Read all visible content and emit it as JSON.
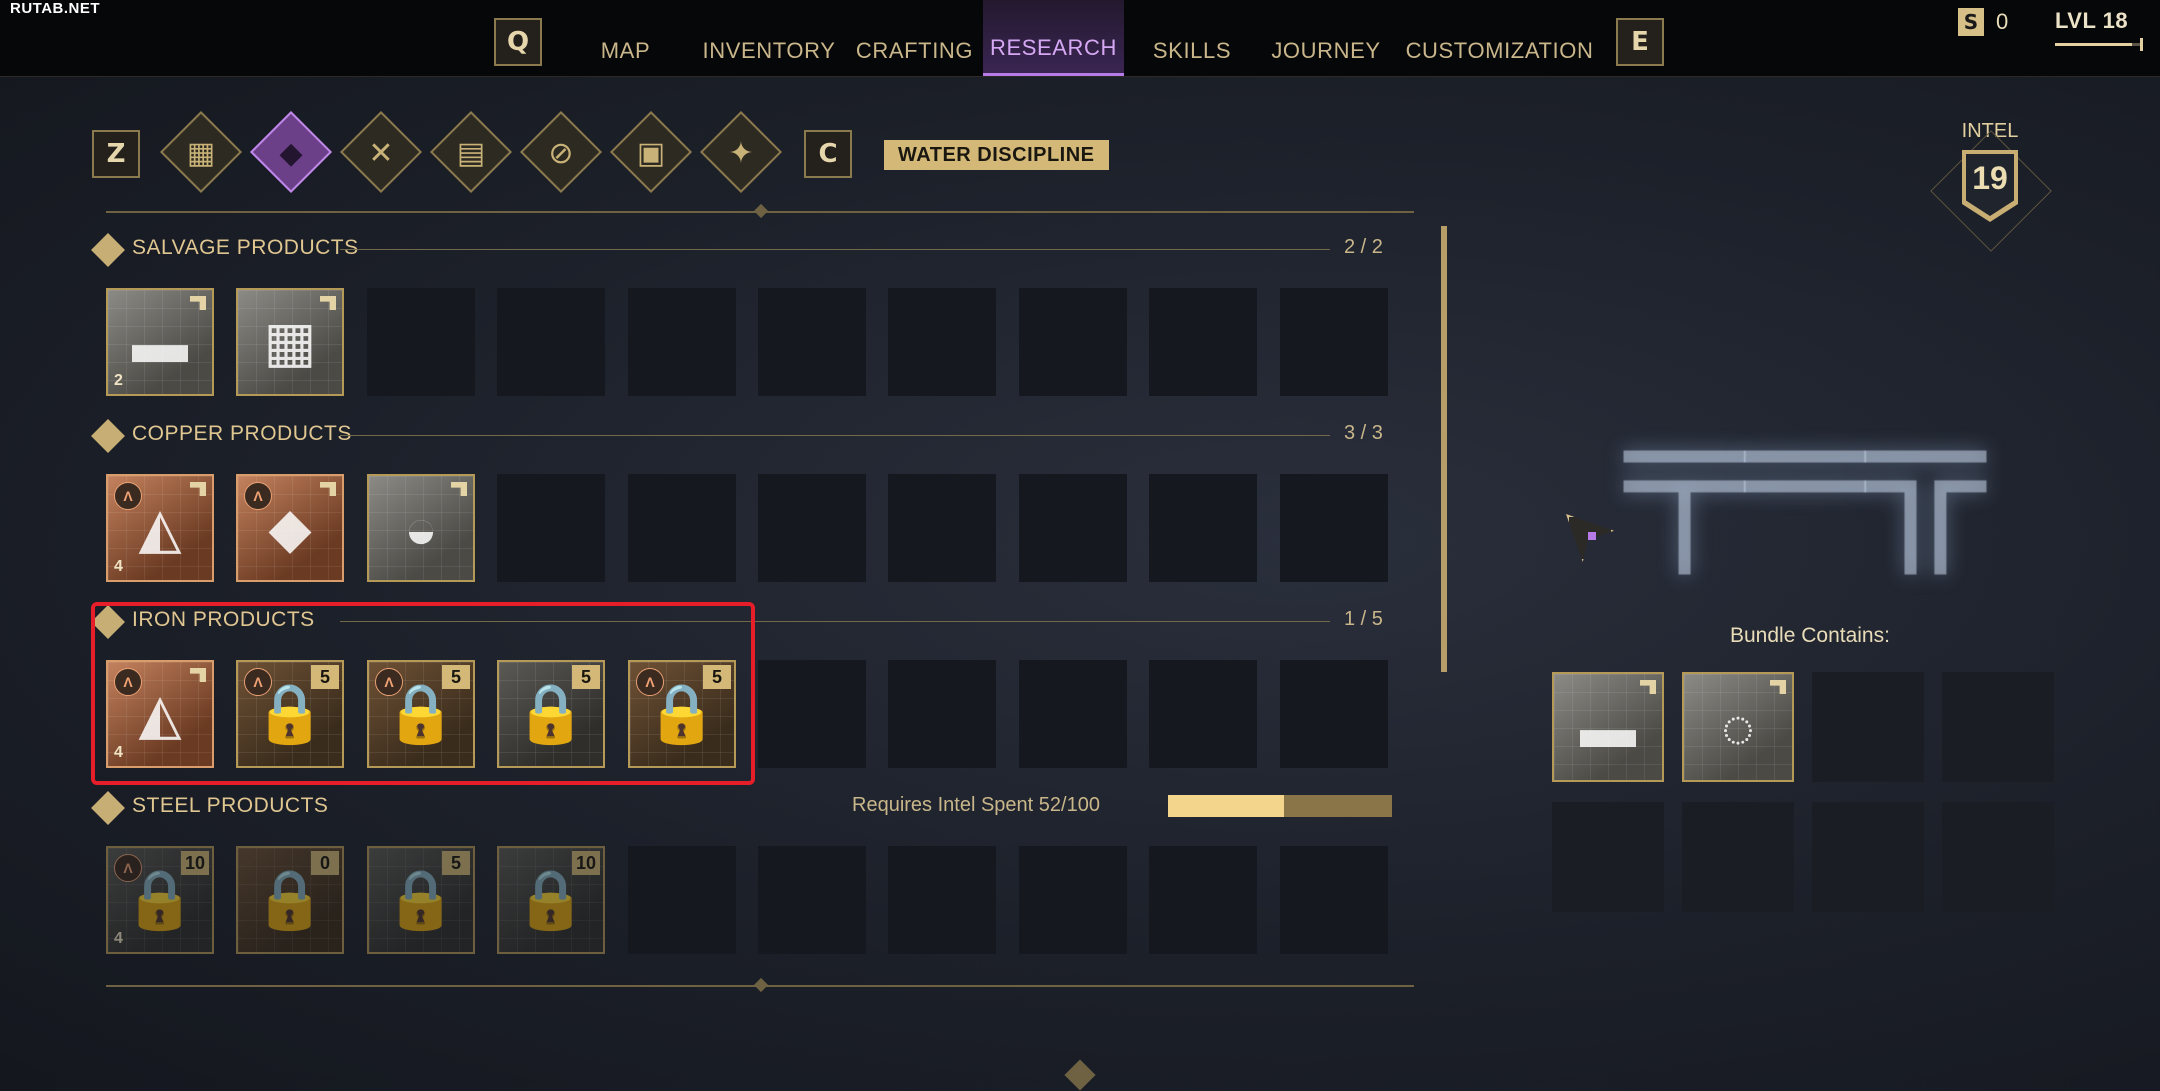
{
  "watermark": "RUTAB.NET",
  "nav": {
    "prev_key": "Q",
    "next_key": "E",
    "tabs": [
      {
        "label": "MAP"
      },
      {
        "label": "INVENTORY"
      },
      {
        "label": "CRAFTING"
      },
      {
        "label": "RESEARCH",
        "active": true
      },
      {
        "label": "SKILLS"
      },
      {
        "label": "JOURNEY"
      },
      {
        "label": "CUSTOMIZATION"
      }
    ]
  },
  "currency": {
    "icon": "S",
    "value": "0"
  },
  "player": {
    "level_label": "LVL 18",
    "xp_progress": 0.9
  },
  "disciplines": {
    "prev_key": "Z",
    "next_key": "C",
    "tab_icons": [
      "grid-icon",
      "water-drop-icon",
      "crossed-tools-icon",
      "bricks-icon",
      "no-fire-icon",
      "module-icon",
      "sparkle-icon"
    ],
    "active_index": 1,
    "current_label": "WATER DISCIPLINE"
  },
  "sections": [
    {
      "title": "SALVAGE PRODUCTS",
      "count": "2 / 2",
      "items": [
        {
          "name": "salvage-smg-item",
          "style": "white",
          "glyph": "▬",
          "stack": "2",
          "tag": true
        },
        {
          "name": "salvage-workbench-item",
          "style": "white",
          "glyph": "▦",
          "tag": true
        }
      ]
    },
    {
      "title": "COPPER PRODUCTS",
      "count": "3 / 3",
      "items": [
        {
          "name": "copper-armor-item",
          "style": "copper",
          "glyph": "◭",
          "stack": "4",
          "tier": "A",
          "tag": true
        },
        {
          "name": "copper-ammo-item",
          "style": "copper",
          "glyph": "◆",
          "tier": "A",
          "tag": true
        },
        {
          "name": "copper-helmet-item",
          "style": "white",
          "glyph": "◒",
          "tag": true
        }
      ]
    },
    {
      "title": "IRON PRODUCTS",
      "count": "1 / 5",
      "items": [
        {
          "name": "iron-armor-item",
          "style": "copper",
          "glyph": "◭",
          "stack": "4",
          "tier": "A",
          "tag": true
        },
        {
          "name": "iron-locked-item-1",
          "style": "violet",
          "locked": true,
          "cost": "5",
          "tier": "A"
        },
        {
          "name": "iron-locked-item-2",
          "style": "violet",
          "locked": true,
          "cost": "5",
          "tier": "A"
        },
        {
          "name": "iron-locked-item-3",
          "style": "gray",
          "locked": true,
          "cost": "5"
        },
        {
          "name": "iron-locked-item-4",
          "style": "violet",
          "locked": true,
          "cost": "5",
          "tier": "A"
        }
      ]
    },
    {
      "title": "STEEL PRODUCTS",
      "requirement": "Requires Intel Spent 52/100",
      "requirement_progress": 0.52,
      "items": [
        {
          "name": "steel-locked-item-1",
          "style": "gray",
          "locked": true,
          "lock_color": "gray",
          "cost": "10",
          "tier": "A",
          "stack": "4",
          "dim": true
        },
        {
          "name": "steel-locked-item-2",
          "style": "violet",
          "locked": true,
          "cost": "0",
          "dim": true
        },
        {
          "name": "steel-locked-item-3",
          "style": "gray",
          "locked": true,
          "lock_color": "gray",
          "cost": "5",
          "dim": true
        },
        {
          "name": "steel-locked-item-4",
          "style": "gray",
          "locked": true,
          "lock_color": "gray",
          "cost": "10",
          "dim": true
        }
      ]
    }
  ],
  "intel": {
    "label": "INTEL",
    "value": "19"
  },
  "bundle": {
    "label": "Bundle Contains:",
    "items": [
      {
        "name": "bundle-smg-item",
        "glyph": "▬"
      },
      {
        "name": "bundle-sling-item",
        "glyph": "◌"
      }
    ]
  },
  "colors": {
    "accent_active": "#b77be6",
    "gold": "#d3b878",
    "highlight": "#e51e2a"
  }
}
